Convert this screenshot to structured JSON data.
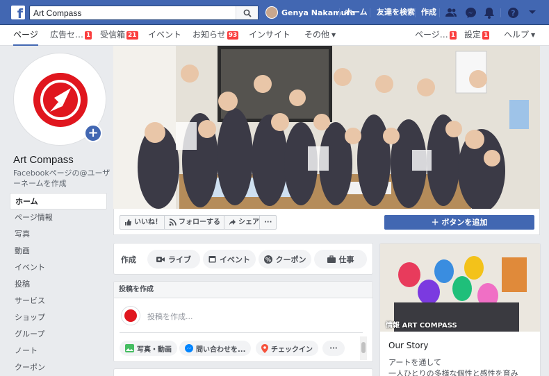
{
  "topbar": {
    "search_value": "Art Compass",
    "user_name": "Genya Nakamura",
    "links": [
      "ホーム",
      "友達を検索",
      "作成"
    ],
    "icons": [
      "friends-icon",
      "messenger-icon",
      "notifications-icon",
      "help-icon",
      "menu-caret-icon"
    ]
  },
  "subnav": {
    "items": [
      {
        "label": "ページ",
        "badge": ""
      },
      {
        "label": "広告セ…",
        "badge": "1"
      },
      {
        "label": "受信箱",
        "badge": "21"
      },
      {
        "label": "イベント",
        "badge": ""
      },
      {
        "label": "お知らせ",
        "badge": "93"
      },
      {
        "label": "インサイト",
        "badge": ""
      },
      {
        "label": "その他",
        "badge": ""
      }
    ],
    "right_items": [
      {
        "label": "ページ…",
        "badge": "1"
      },
      {
        "label": "設定",
        "badge": "1"
      },
      {
        "label": "ヘルプ",
        "badge": ""
      }
    ]
  },
  "page": {
    "name": "Art Compass",
    "handle": "Facebookページの@ユーザーネームを作成"
  },
  "left_nav": [
    "ホーム",
    "ページ情報",
    "写真",
    "動画",
    "イベント",
    "投稿",
    "サービス",
    "ショップ",
    "グループ",
    "ノート",
    "クーポン"
  ],
  "actions": {
    "like": "いいね！",
    "follow": "フォローする",
    "share": "シェア",
    "more": "···",
    "add_button": "＋ ボタンを追加"
  },
  "create": {
    "label": "作成",
    "pills": [
      "ライブ",
      "イベント",
      "クーポン",
      "仕事"
    ]
  },
  "composer": {
    "header": "投稿を作成",
    "placeholder": "投稿を作成...",
    "chips": [
      "写真・動画",
      "問い合わせを...",
      "チェックイン",
      "···"
    ]
  },
  "story": {
    "caption": "情報 ART COMPASS",
    "title": "Our Story",
    "text_line1": "アートを通して",
    "text_line2": "一人ひとりの多様な個性と感性を育み"
  },
  "colors": {
    "brand_blue": "#4267b2",
    "logo_red": "#e0161e",
    "badge_red": "#fa3e3e"
  }
}
